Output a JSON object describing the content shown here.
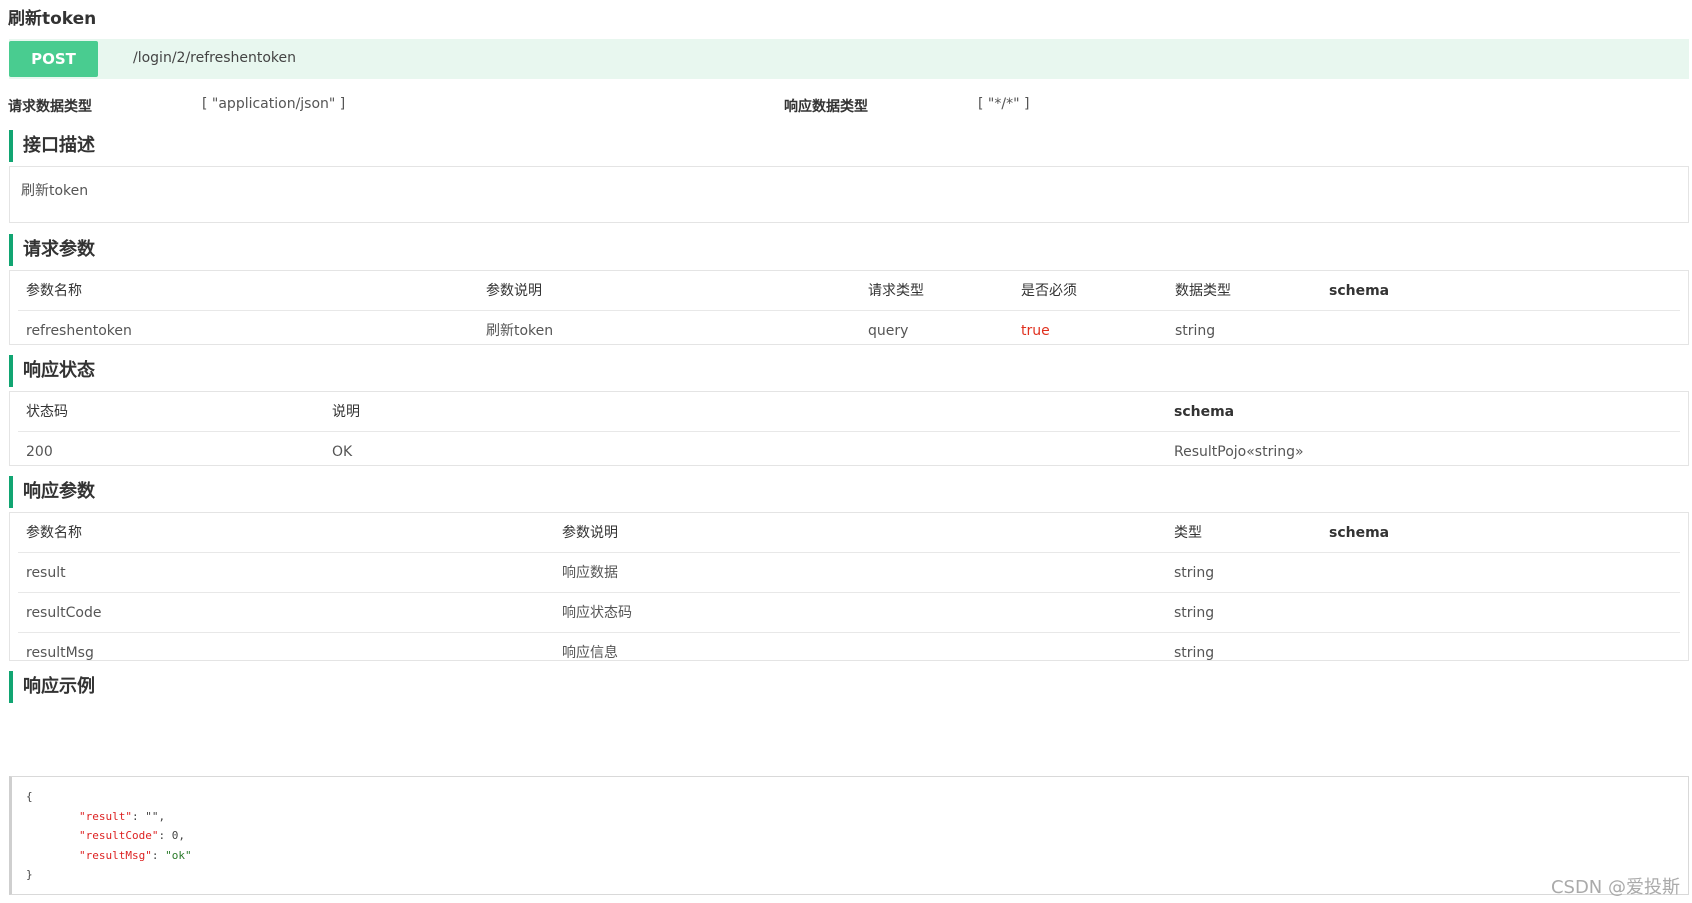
{
  "operation": {
    "title": "刷新token",
    "method": "POST",
    "path": "/login/2/refreshentoken",
    "method_color": "#49cc90",
    "bar_color": "#e8f7ef"
  },
  "meta": {
    "request_type_label": "请求数据类型",
    "request_type_value": "[ \"application/json\" ]",
    "response_type_label": "响应数据类型",
    "response_type_value": "[ \"*/*\" ]"
  },
  "sections": {
    "description_title": "接口描述",
    "description_text": "刷新token",
    "request_params_title": "请求参数",
    "response_status_title": "响应状态",
    "response_params_title": "响应参数",
    "response_example_title": "响应示例"
  },
  "request_params": {
    "headers": [
      "参数名称",
      "参数说明",
      "请求类型",
      "是否必须",
      "数据类型",
      "schema"
    ],
    "rows": [
      [
        "refreshentoken",
        "刷新token",
        "query",
        "true",
        "string",
        ""
      ]
    ]
  },
  "response_status": {
    "headers": [
      "状态码",
      "说明",
      "schema"
    ],
    "rows": [
      [
        "200",
        "OK",
        "ResultPojo«string»"
      ]
    ]
  },
  "response_params": {
    "headers": [
      "参数名称",
      "参数说明",
      "类型",
      "schema"
    ],
    "rows": [
      [
        "result",
        "响应数据",
        "string",
        ""
      ],
      [
        "resultCode",
        "响应状态码",
        "string",
        ""
      ],
      [
        "resultMsg",
        "响应信息",
        "string",
        ""
      ]
    ]
  },
  "response_example": {
    "open": "{",
    "close": "}",
    "fields": [
      {
        "key": "\"result\"",
        "value": "\"\"",
        "sep": ","
      },
      {
        "key": "\"resultCode\"",
        "value": "0",
        "sep": ","
      },
      {
        "key": "\"resultMsg\"",
        "value": "\"ok\"",
        "sep": ""
      }
    ]
  },
  "watermark": "CSDN @爱投斯",
  "accent_color": "#11a572",
  "required_color": "#e0301e"
}
